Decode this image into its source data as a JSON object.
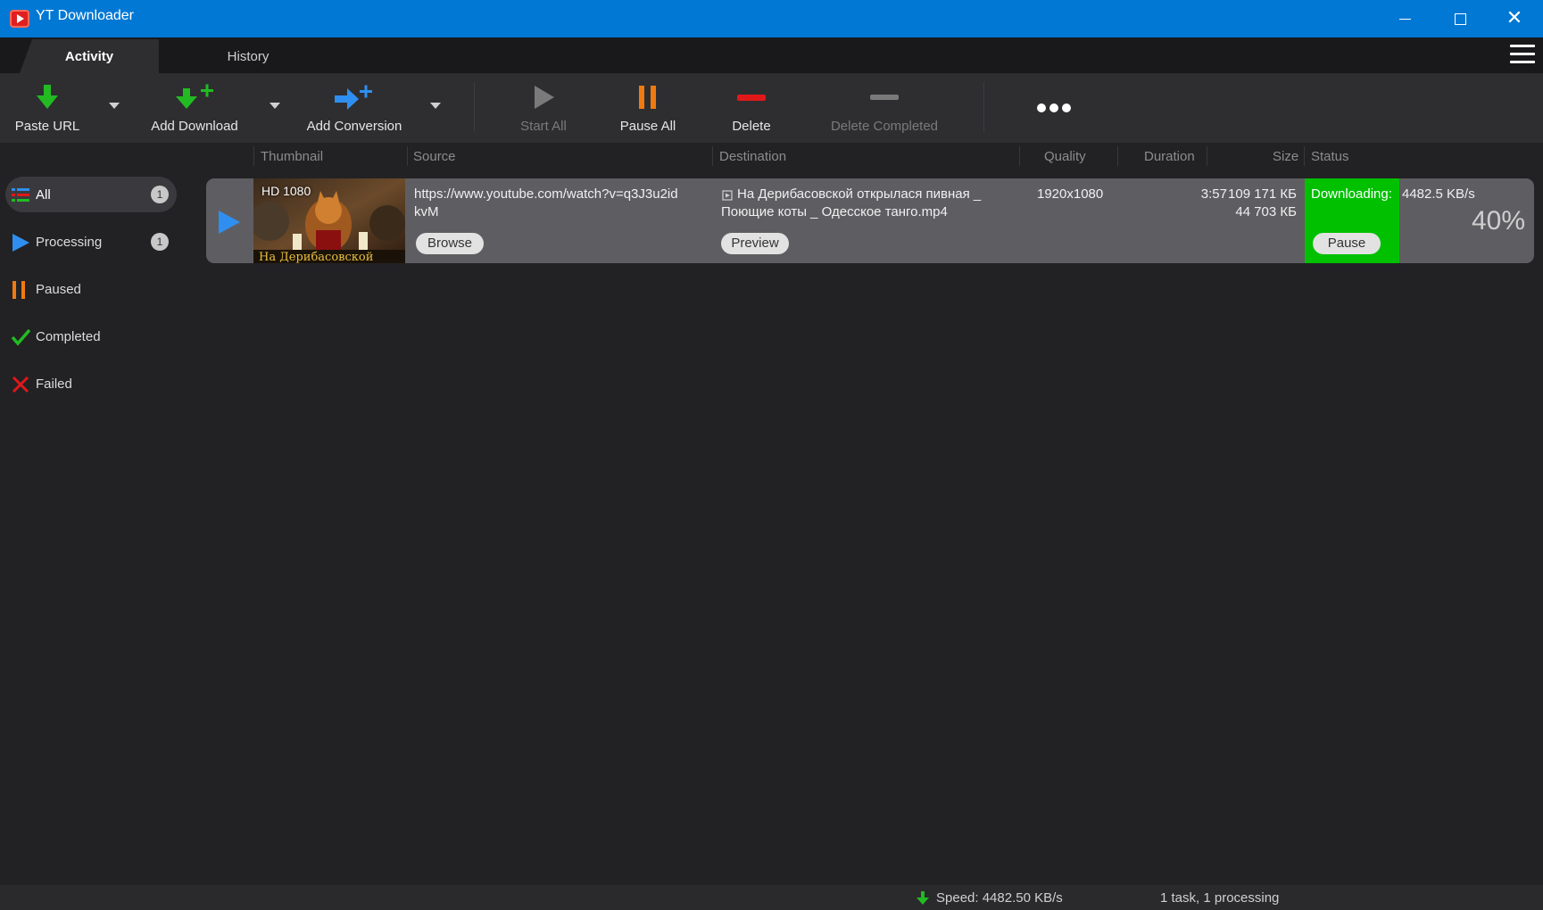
{
  "window": {
    "title": "YT Downloader"
  },
  "tabs": [
    {
      "label": "Activity"
    },
    {
      "label": "History"
    }
  ],
  "toolbar": {
    "paste_url": "Paste URL",
    "add_download": "Add Download",
    "add_conversion": "Add Conversion",
    "start_all": "Start All",
    "pause_all": "Pause All",
    "delete": "Delete",
    "delete_completed": "Delete Completed"
  },
  "sidebar": {
    "items": [
      {
        "label": "All",
        "count": "1",
        "icon": "list-icon"
      },
      {
        "label": "Processing",
        "count": "1",
        "icon": "play-icon"
      },
      {
        "label": "Paused",
        "icon": "pause-icon"
      },
      {
        "label": "Completed",
        "icon": "check-icon"
      },
      {
        "label": "Failed",
        "icon": "cross-icon"
      }
    ]
  },
  "columns": {
    "thumbnail": "Thumbnail",
    "source": "Source",
    "destination": "Destination",
    "quality": "Quality",
    "duration": "Duration",
    "size": "Size",
    "status": "Status"
  },
  "rows": [
    {
      "thumbnail_badge": "HD 1080",
      "source_line1": "https://www.youtube.com/watch?v=q3J3u2id",
      "source_line2": "kvM",
      "browse": "Browse",
      "dest_line1": "На Дерибасовской открылася пивная _",
      "dest_line2": "Поющие коты _ Одесское танго.mp4",
      "preview": "Preview",
      "quality": "1920x1080",
      "duration": "3:57",
      "size_total": "109 171 КБ",
      "size_done": "44 703 КБ",
      "status_label": "Downloading:",
      "status_speed": "4482.5 KB/s",
      "pause": "Pause",
      "progress_text": "40%",
      "progress": 0.4
    }
  ],
  "statusbar": {
    "speed": "Speed: 4482.50 KB/s",
    "tasks": "1 task, 1 processing"
  },
  "colors": {
    "titlebar": "#0078d4",
    "download_green": "#22bb22",
    "conversion_blue": "#2f8ff0",
    "pause_orange": "#f07a10",
    "delete_red": "#e01818",
    "status_green": "#00c000"
  }
}
